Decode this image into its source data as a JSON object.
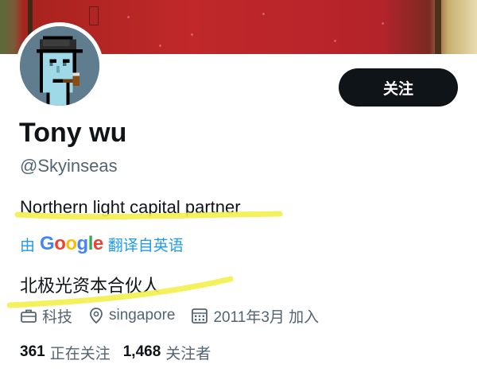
{
  "profile": {
    "name": "Tony wu",
    "handle": "@Skyinseas",
    "follow_label": "关注",
    "bio": "Northern light capital partner",
    "bio_translated": "北极光资本合伙人",
    "translate": {
      "prefix": "由",
      "google": [
        "G",
        "o",
        "o",
        "g",
        "l",
        "e"
      ],
      "suffix": "翻译自英语"
    },
    "meta": {
      "category": "科技",
      "location": "singapore",
      "joined": "2011年3月 加入"
    },
    "stats": {
      "following_count": "361",
      "following_label": "正在关注",
      "followers_count": "1,468",
      "followers_label": "关注者"
    }
  },
  "colors": {
    "link": "#1d9bf0",
    "secondary_text": "#536471",
    "highlighter": "#f3f04a",
    "button_bg": "#0f1419"
  },
  "icons": [
    "briefcase-icon",
    "location-pin-icon",
    "calendar-icon"
  ]
}
